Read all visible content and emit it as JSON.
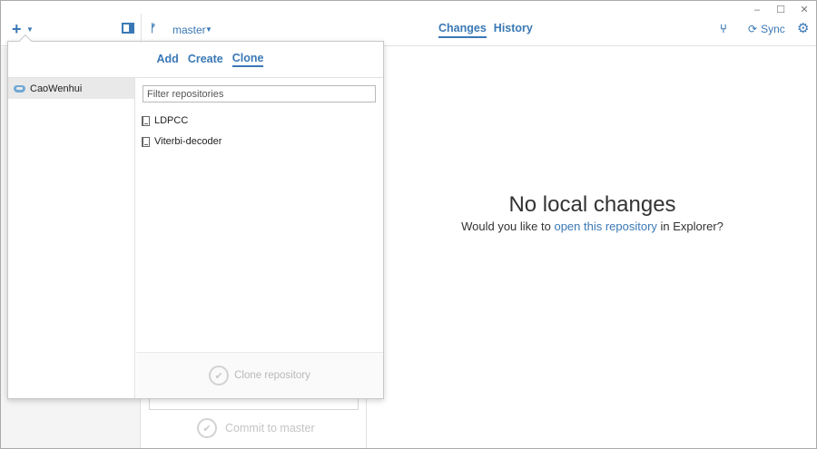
{
  "window": {
    "minimize_label": "–",
    "maximize_label": "☐",
    "close_label": "✕"
  },
  "toolbar": {
    "add_label": "+",
    "branch_icon": "git-branch-icon",
    "branch_name": "master",
    "tabs": [
      {
        "label": "Changes",
        "active": true
      },
      {
        "label": "History",
        "active": false
      }
    ],
    "sync_label": "Sync"
  },
  "main": {
    "empty_title": "No local changes",
    "empty_sub_prefix": "Would you like to ",
    "empty_sub_link": "open this repository",
    "empty_sub_suffix": " in Explorer?"
  },
  "commit_panel": {
    "commit_label": "Commit to master"
  },
  "popup": {
    "tabs": [
      {
        "label": "Add",
        "active": false
      },
      {
        "label": "Create",
        "active": false
      },
      {
        "label": "Clone",
        "active": true
      }
    ],
    "account": "CaoWenhui",
    "filter_placeholder": "Filter repositories",
    "repositories": [
      "LDPCC",
      "Viterbi-decoder"
    ],
    "clone_button": "Clone repository"
  },
  "colors": {
    "accent": "#3a78b5",
    "disabled": "#b8b8b8",
    "selected_bg": "#e9e9e9"
  }
}
